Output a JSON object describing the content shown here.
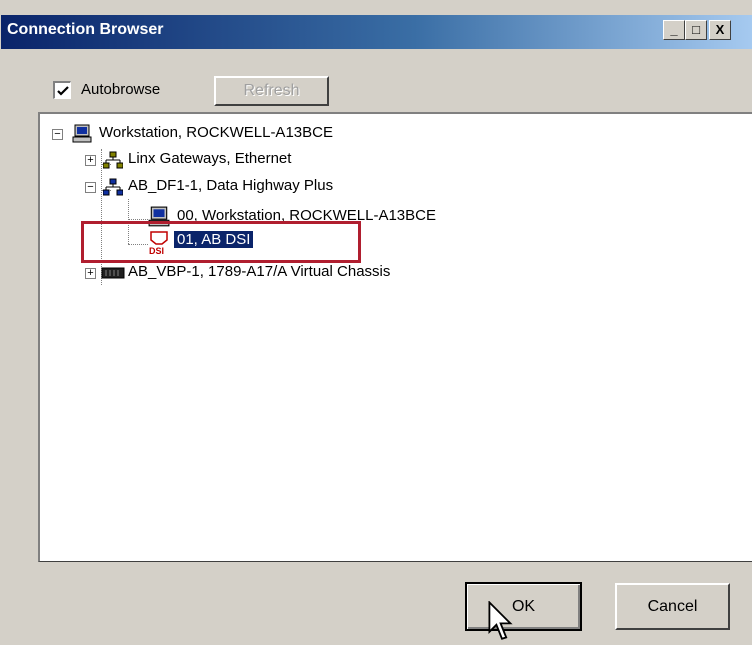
{
  "window": {
    "title": "Connection Browser"
  },
  "titlebar_buttons": {
    "minimize": "_",
    "maximize": "□",
    "close": "X"
  },
  "toolbar": {
    "autobrowse_label": "Autobrowse",
    "autobrowse_checked": true,
    "refresh_label": "Refresh"
  },
  "tree": {
    "root": {
      "label": "Workstation, ROCKWELL-A13BCE",
      "icon": "workstation-icon",
      "expanded": true
    },
    "items": [
      {
        "label": "Linx Gateways, Ethernet",
        "icon": "network-icon",
        "expanded": false
      },
      {
        "label": "AB_DF1-1, Data Highway Plus",
        "icon": "network-icon",
        "expanded": true,
        "children": [
          {
            "label": "00, Workstation, ROCKWELL-A13BCE",
            "icon": "workstation-icon"
          },
          {
            "label": "01, AB DSI",
            "icon": "dsi-icon",
            "selected": true
          }
        ]
      },
      {
        "label": "AB_VBP-1, 1789-A17/A Virtual Chassis",
        "icon": "chassis-icon",
        "expanded": false
      }
    ]
  },
  "footer": {
    "ok_label": "OK",
    "cancel_label": "Cancel"
  },
  "colors": {
    "titlebar": "#0a246a",
    "selection": "#0a246a",
    "highlight_box": "#b01e2f",
    "face": "#d4d0c8"
  }
}
